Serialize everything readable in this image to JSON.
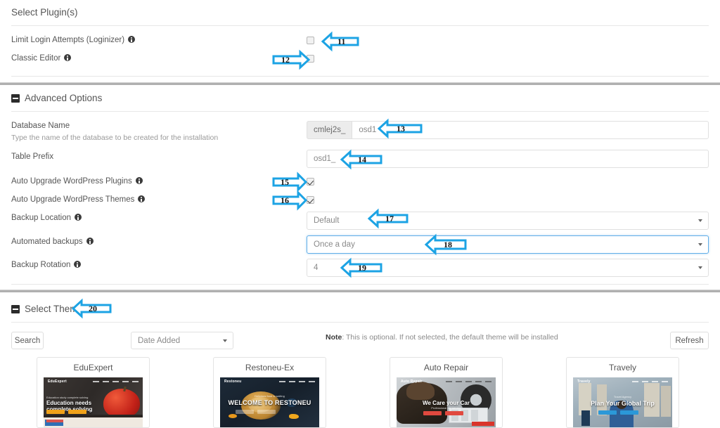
{
  "plugins_section": {
    "title": "Select Plugin(s)",
    "items": [
      {
        "label": "Limit Login Attempts (Loginizer)",
        "checked": false
      },
      {
        "label": "Classic Editor",
        "checked": false
      }
    ]
  },
  "advanced_section": {
    "title": "Advanced Options",
    "database_name": {
      "label": "Database Name",
      "description": "Type the name of the database to be created for the installation",
      "prefix": "cmlej2s_",
      "value": "osd1"
    },
    "table_prefix": {
      "label": "Table Prefix",
      "value": "osd1_"
    },
    "auto_upgrade_plugins": {
      "label": "Auto Upgrade WordPress Plugins",
      "checked": true
    },
    "auto_upgrade_themes": {
      "label": "Auto Upgrade WordPress Themes",
      "checked": true
    },
    "backup_location": {
      "label": "Backup Location",
      "value": "Default"
    },
    "automated_backups": {
      "label": "Automated backups",
      "value": "Once a day"
    },
    "backup_rotation": {
      "label": "Backup Rotation",
      "value": "4"
    }
  },
  "theme_section": {
    "title": "Select Theme",
    "search_button": "Search",
    "sort_select": "Date Added",
    "note_label": "Note",
    "note_text": ": This is optional. If not selected, the default theme will be installed",
    "refresh_button": "Refresh",
    "themes": [
      {
        "name": "EduExpert",
        "headline": "Education needs complete solving",
        "brand": "EduExpert",
        "kicker": "Education study complete solving"
      },
      {
        "name": "Restoneu-Ex",
        "headline": "WELCOME TO RESTONEU",
        "brand": "Restoneu",
        "kicker": "Delicious food is waiting"
      },
      {
        "name": "Auto Repair",
        "headline": "We Care your Car",
        "brand": "Auto Repair",
        "kicker": "Professional car service"
      },
      {
        "name": "Travely",
        "headline": "Plan Your Global Trip",
        "brand": "Travely",
        "kicker": "Travel Agency"
      }
    ]
  },
  "annotations": {
    "accent_color": "#1CA3E4",
    "markers": [
      {
        "id": "11",
        "dir": "left"
      },
      {
        "id": "12",
        "dir": "right"
      },
      {
        "id": "13",
        "dir": "left"
      },
      {
        "id": "14",
        "dir": "left"
      },
      {
        "id": "15",
        "dir": "right"
      },
      {
        "id": "16",
        "dir": "right"
      },
      {
        "id": "17",
        "dir": "left"
      },
      {
        "id": "18",
        "dir": "left"
      },
      {
        "id": "19",
        "dir": "left"
      },
      {
        "id": "20",
        "dir": "left"
      }
    ]
  }
}
